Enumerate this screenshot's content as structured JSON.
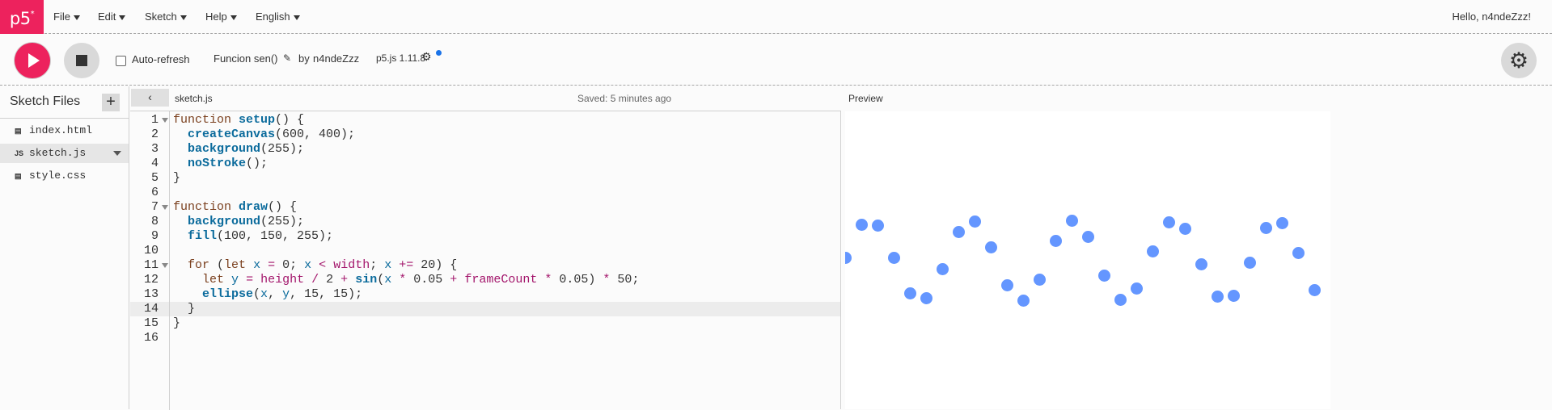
{
  "nav": {
    "logo": "p5",
    "logo_mark": "*",
    "menu": [
      {
        "label": "File"
      },
      {
        "label": "Edit"
      },
      {
        "label": "Sketch"
      },
      {
        "label": "Help"
      },
      {
        "label": "English"
      }
    ],
    "greeting": "Hello, n4ndeZzz!"
  },
  "toolbar": {
    "auto_refresh_label": "Auto-refresh",
    "auto_refresh_checked": false,
    "sketch_name": "Funcion sen()",
    "pencil_icon": "✎",
    "by_label": "by",
    "author": "n4ndeZzz",
    "version": "p5.js 1.11.8",
    "gear_icon": "⚙"
  },
  "sidebar": {
    "title": "Sketch Files",
    "add_label": "+",
    "files": [
      {
        "name": "index.html",
        "icon": "▤",
        "selected": false
      },
      {
        "name": "sketch.js",
        "icon": "JS",
        "selected": true
      },
      {
        "name": "style.css",
        "icon": "▤",
        "selected": false
      }
    ]
  },
  "editor": {
    "collapse_icon": "‹",
    "tab": "sketch.js",
    "saved": "Saved: 5 minutes ago",
    "active_line": 14,
    "lines": [
      {
        "n": "1",
        "fold": true,
        "code": "function setup() {"
      },
      {
        "n": "2",
        "fold": false,
        "code": "  createCanvas(600, 400);"
      },
      {
        "n": "3",
        "fold": false,
        "code": "  background(255);"
      },
      {
        "n": "4",
        "fold": false,
        "code": "  noStroke();"
      },
      {
        "n": "5",
        "fold": false,
        "code": "}"
      },
      {
        "n": "6",
        "fold": false,
        "code": ""
      },
      {
        "n": "7",
        "fold": true,
        "code": "function draw() {"
      },
      {
        "n": "8",
        "fold": false,
        "code": "  background(255);"
      },
      {
        "n": "9",
        "fold": false,
        "code": "  fill(100, 150, 255);"
      },
      {
        "n": "10",
        "fold": false,
        "code": ""
      },
      {
        "n": "11",
        "fold": true,
        "code": "  for (let x = 0; x < width; x += 20) {"
      },
      {
        "n": "12",
        "fold": false,
        "code": "    let y = height / 2 + sin(x * 0.05 + frameCount * 0.05) * 50;"
      },
      {
        "n": "13",
        "fold": false,
        "code": "    ellipse(x, y, 15, 15);"
      },
      {
        "n": "14",
        "fold": false,
        "code": "  }"
      },
      {
        "n": "15",
        "fold": false,
        "code": "}"
      },
      {
        "n": "16",
        "fold": false,
        "code": ""
      }
    ]
  },
  "preview": {
    "label": "Preview",
    "dot_color": "#6496ff",
    "dot_diameter": 15,
    "dot_x_step": 20,
    "wave_amplitude": 50,
    "wave_frequency": 0.05,
    "wave_phase": 3.22,
    "canvas_size": [
      600,
      400
    ]
  },
  "colors": {
    "accent": "#ed225d",
    "button_gray": "#d9d9d9",
    "dot": "#6496ff"
  }
}
